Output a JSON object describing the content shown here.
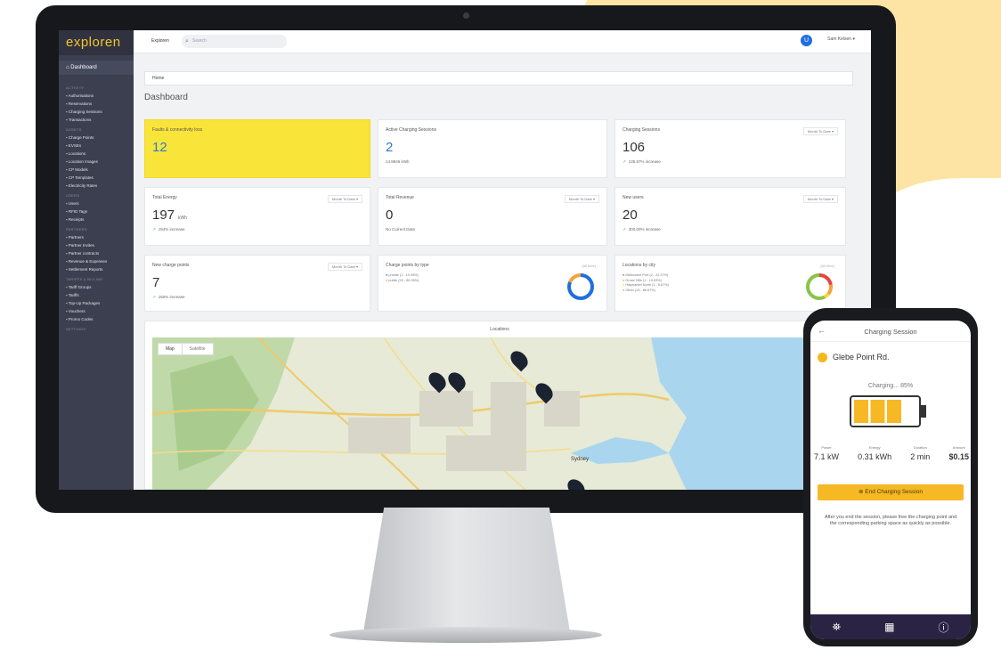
{
  "app": {
    "logo": "exploren",
    "nav_home": "Dashboard",
    "topbar": {
      "name": "Exploren",
      "search_placeholder": "Search"
    },
    "user": {
      "name": "Sam Kelsen",
      "avatar_letter": "U"
    }
  },
  "sidebar": {
    "sections": [
      {
        "title": "Activity",
        "items": [
          "Authorisations",
          "Reservations",
          "Charging Sessions",
          "Transactions"
        ]
      },
      {
        "title": "Assets",
        "items": [
          "Charge Points",
          "EVSEs",
          "Locations",
          "Location Images",
          "CP Models",
          "CP Templates",
          "Electricity Rates"
        ]
      },
      {
        "title": "Users",
        "items": [
          "Users",
          "RFID Tags",
          "Receipts"
        ]
      },
      {
        "title": "Partners",
        "items": [
          "Partners",
          "Partner Invites",
          "Partner contracts",
          "Revenue & Expenses",
          "Settlement Reports"
        ]
      },
      {
        "title": "Tariffs & Billing",
        "items": [
          "Tariff Groups",
          "Tariffs",
          "Top-Up Packages",
          "Vouchers",
          "Promo Codes"
        ]
      },
      {
        "title": "Settings",
        "items": []
      }
    ]
  },
  "breadcrumb": "Home",
  "page_title": "Dashboard",
  "cards": {
    "faults": {
      "title": "Faults & connectivity loss",
      "value": "12"
    },
    "active": {
      "title": "Active Charging Sessions",
      "value": "2",
      "sub": "14.8846 kWh"
    },
    "sessions": {
      "title": "Charging Sessions",
      "value": "106",
      "sub": "135.67% increase",
      "period": "Month To Date"
    },
    "energy": {
      "title": "Total Energy",
      "value": "197",
      "unit": "kWh",
      "sub": "194% increase",
      "period": "Month To Date"
    },
    "revenue": {
      "title": "Total Revenue",
      "value": "0",
      "sub": "No Current Data",
      "period": "Month To Date"
    },
    "new_users": {
      "title": "New users",
      "value": "20",
      "sub": "300.00% increase",
      "period": "Month To Date"
    },
    "new_cp": {
      "title": "New charge points",
      "value": "7",
      "sub": "150% increase",
      "period": "Month To Date"
    },
    "cp_type": {
      "title": "Charge points by type",
      "tag": "(All time)",
      "legend": [
        "private (1 - 19.05%)",
        "public (23 - 80.95%)"
      ],
      "colors": [
        "#1f6fe0",
        "#f4a33a"
      ],
      "shares": [
        0.8095,
        0.1905
      ]
    },
    "loc_city": {
      "title": "Locations by city",
      "tag": "(All time)",
      "legend": [
        "Melbourne Port (2 - 22.27%)",
        "Grose Hills (1 - 13.33%)",
        "Haymarket North (1 - 6.67%)",
        "Other (13 - 86.67%)"
      ],
      "colors": [
        "#e2483c",
        "#f4a33a",
        "#f4d43a",
        "#8bc34a"
      ],
      "shares": [
        0.2227,
        0.1333,
        0.0667,
        0.5773
      ]
    }
  },
  "locations": {
    "title": "Locations",
    "map_tabs": [
      "Map",
      "Satellite"
    ],
    "place_label": "Sydney"
  },
  "phone": {
    "title": "Charging Session",
    "site": "Glebe Point Rd.",
    "status": "Charging... 85%",
    "charge_level": 0.85,
    "stats": [
      {
        "label": "Power",
        "value": "7.1 kW"
      },
      {
        "label": "Energy",
        "value": "0.31 kWh"
      },
      {
        "label": "Duration",
        "value": "2 min"
      },
      {
        "label": "Amount",
        "value": "$0.15"
      }
    ],
    "button": "End Charging Session",
    "note": "After you end the session, please free the charging point and the corresponding parking space as quickly as possible."
  }
}
